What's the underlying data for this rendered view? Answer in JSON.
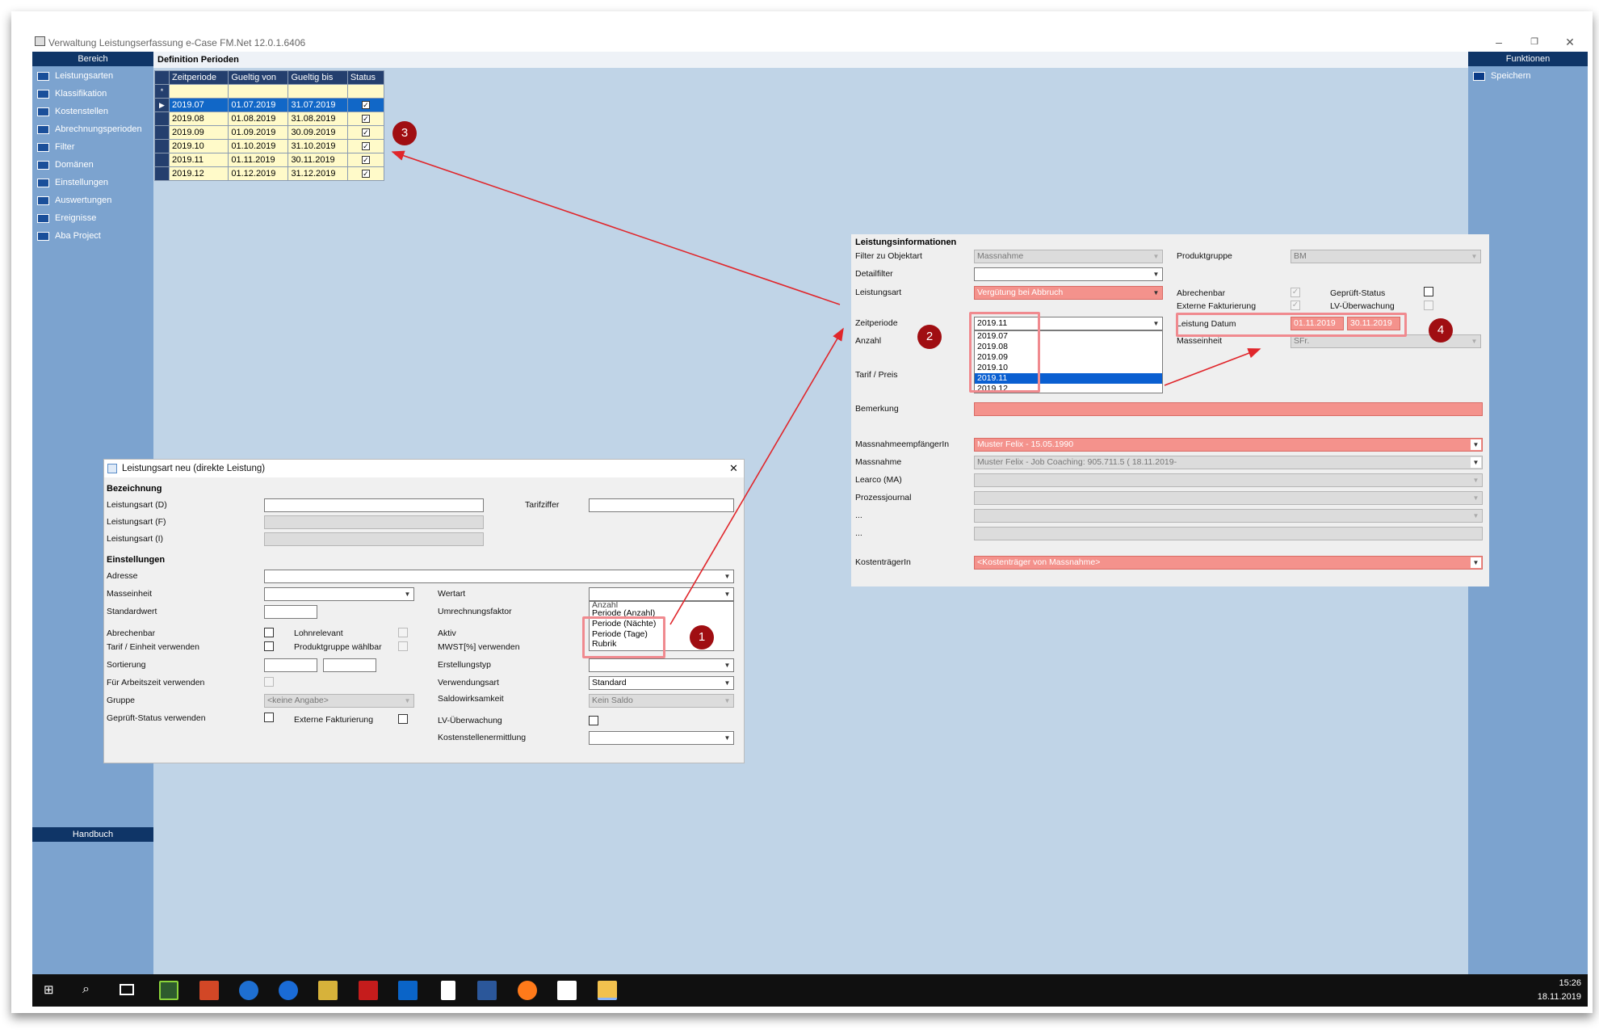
{
  "window": {
    "title": "Verwaltung Leistungserfassung e-Case FM.Net 12.0.1.6406"
  },
  "left_sidebar": {
    "header": "Bereich",
    "items": [
      "Leistungsarten",
      "Klassifikation",
      "Kostenstellen",
      "Abrechnungsperioden",
      "Filter",
      "Domänen",
      "Einstellungen",
      "Auswertungen",
      "Ereignisse",
      "Aba Project"
    ],
    "footer": "Handbuch"
  },
  "right_sidebar": {
    "header": "Funktionen",
    "items": [
      "Speichern"
    ]
  },
  "periods": {
    "title": "Definition Perioden",
    "columns": [
      "Zeitperiode",
      "Gueltig von",
      "Gueltig bis",
      "Status"
    ],
    "new_row_marker": "*",
    "rows": [
      {
        "period": "2019.07",
        "from": "01.07.2019",
        "to": "31.07.2019",
        "status": true
      },
      {
        "period": "2019.08",
        "from": "01.08.2019",
        "to": "31.08.2019",
        "status": true
      },
      {
        "period": "2019.09",
        "from": "01.09.2019",
        "to": "30.09.2019",
        "status": true
      },
      {
        "period": "2019.10",
        "from": "01.10.2019",
        "to": "31.10.2019",
        "status": true
      },
      {
        "period": "2019.11",
        "from": "01.11.2019",
        "to": "30.11.2019",
        "status": true
      },
      {
        "period": "2019.12",
        "from": "01.12.2019",
        "to": "31.12.2019",
        "status": true
      }
    ]
  },
  "info": {
    "header": "Leistungsinformationen",
    "filter_label": "Filter zu Objektart",
    "filter_value": "Massnahme",
    "produktgruppe_label": "Produktgruppe",
    "produktgruppe_value": "BM",
    "detailfilter_label": "Detailfilter",
    "leistungsart_label": "Leistungsart",
    "leistungsart_value": "Vergütung bei Abbruch",
    "abrechenbar_label": "Abrechenbar",
    "geprueft_label": "Geprüft-Status",
    "extern_label": "Externe Fakturierung",
    "lv_label": "LV-Überwachung",
    "zeitperiode_label": "Zeitperiode",
    "zeitperiode_value": "2019.11",
    "zeitperiode_options": [
      "2019.07",
      "2019.08",
      "2019.09",
      "2019.10",
      "2019.11",
      "2019.12"
    ],
    "leistung_datum_label": "Leistung Datum",
    "datum_von": "01.11.2019",
    "datum_bis": "30.11.2019",
    "anzahl_label": "Anzahl",
    "masseinheit_label": "Masseinheit",
    "masseinheit_value": "SFr.",
    "tarif_label": "Tarif / Preis",
    "bemerkung_label": "Bemerkung",
    "empfaenger_label": "MassnahmeempfängerIn",
    "empfaenger_value": "Muster Felix -  15.05.1990",
    "massnahme_label": "Massnahme",
    "massnahme_value": "Muster Felix - Job Coaching: 905.711.5 ( 18.11.2019-",
    "learco_label": "Learco (MA)",
    "prozess_label": "Prozessjournal",
    "dots1": "...",
    "dots2": "...",
    "kosten_label": "KostenträgerIn",
    "kosten_value": "<Kostenträger von Massnahme>"
  },
  "dialog": {
    "title": "Leistungsart neu (direkte Leistung)",
    "close": "✕",
    "bezeichnung_header": "Bezeichnung",
    "la_d": "Leistungsart (D)",
    "la_f": "Leistungsart (F)",
    "la_i": "Leistungsart (I)",
    "tarifziffer": "Tarifziffer",
    "einstellungen_header": "Einstellungen",
    "adresse": "Adresse",
    "masseinheit": "Masseinheit",
    "wertart": "Wertart",
    "standardwert": "Standardwert",
    "umrechnungsfaktor": "Umrechnungsfaktor",
    "wertart_options": [
      "Anzahl",
      "Periode (Anzahl)",
      "Periode (Nächte)",
      "Periode (Tage)",
      "Rubrik"
    ],
    "abrechenbar": "Abrechenbar",
    "lohnrelevant": "Lohnrelevant",
    "aktiv": "Aktiv",
    "tarif_einheit": "Tarif / Einheit verwenden",
    "produktgruppe_waehlbar": "Produktgruppe wählbar",
    "mwst": "MWST[%] verwenden",
    "sortierung": "Sortierung",
    "erstellungstyp": "Erstellungstyp",
    "arbeitszeit": "Für Arbeitszeit verwenden",
    "verwendungsart": "Verwendungsart",
    "verwendungsart_value": "Standard",
    "gruppe": "Gruppe",
    "gruppe_value": "<keine Angabe>",
    "saldowirksamkeit": "Saldowirksamkeit",
    "saldo_value": "Kein Saldo",
    "geprueft": "Geprüft-Status verwenden",
    "extern": "Externe Fakturierung",
    "lv": "LV-Überwachung",
    "kostenstellen": "Kostenstellenermittlung"
  },
  "annotations": {
    "badges": [
      "1",
      "2",
      "3",
      "4"
    ],
    "color": "#e0262b"
  },
  "taskbar": {
    "time": "15:26",
    "date": "18.11.2019"
  }
}
